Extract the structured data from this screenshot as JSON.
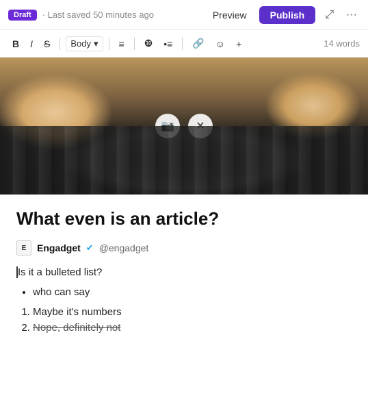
{
  "topbar": {
    "draft_label": "Draft",
    "saved_text": "· Last saved 50 minutes ago",
    "preview_label": "Preview",
    "publish_label": "Publish",
    "fullscreen_icon": "⤢",
    "more_icon": "···"
  },
  "formatbar": {
    "bold_label": "B",
    "italic_label": "I",
    "strikethrough_label": "S",
    "block_select": "Body",
    "chevron": "▾",
    "list_icon": "≡",
    "ol_icon": "≡",
    "ul_icon": "≡",
    "link_icon": "🔗",
    "emoji_icon": "☺",
    "plus_icon": "+",
    "word_count": "14 words"
  },
  "article": {
    "title": "What even is an article?",
    "author_short": "E",
    "author_name": "Engadget",
    "author_handle": "@engadget",
    "intro_text": "Is it a bulleted list?",
    "bullets": [
      {
        "text": "who can say"
      }
    ],
    "numbered": [
      {
        "text": "Maybe it's numbers"
      },
      {
        "text": "Nope, definitely not",
        "strikethrough": true
      }
    ]
  },
  "colors": {
    "publish_bg": "#5b2fc9",
    "draft_bg": "#6c2bd9",
    "verified": "#1da1f2"
  }
}
